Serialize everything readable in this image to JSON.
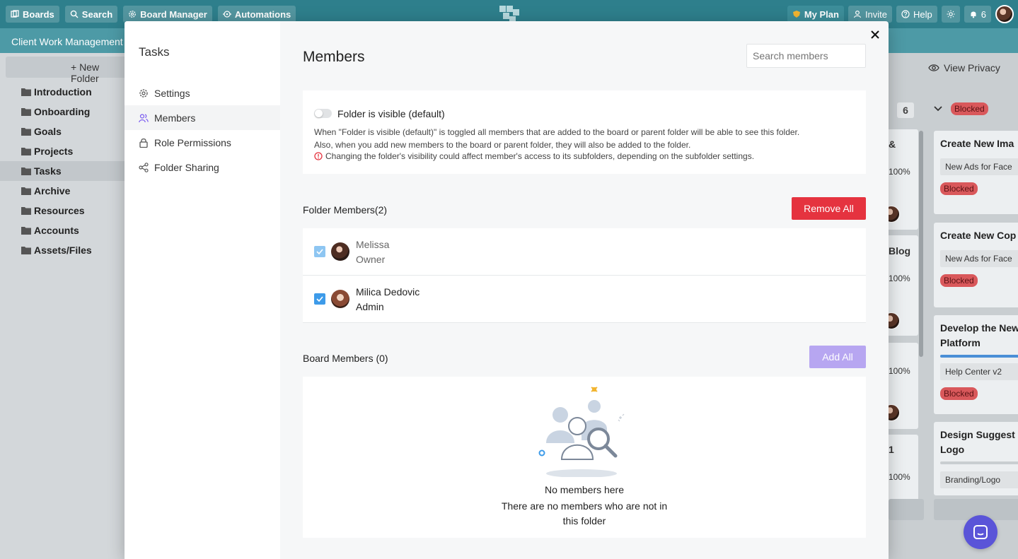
{
  "topbar": {
    "boards": "Boards",
    "search": "Search",
    "board_manager": "Board Manager",
    "automations": "Automations",
    "my_plan": "My Plan",
    "invite": "Invite",
    "help": "Help",
    "notifications_count": "6"
  },
  "workspace": {
    "title": "Client Work Management",
    "new_folder": "+ New Folder"
  },
  "folders": [
    "Introduction",
    "Onboarding",
    "Goals",
    "Projects",
    "Tasks",
    "Archive",
    "Resources",
    "Accounts",
    "Assets/Files"
  ],
  "board": {
    "view_privacy": "View Privacy",
    "column_count": "6",
    "blocked_label": "Blocked",
    "left_cards": [
      {
        "title": "&",
        "percent": "100%"
      },
      {
        "title": "Blog",
        "percent": "100%"
      },
      {
        "title": "",
        "percent": "100%"
      },
      {
        "title": "1",
        "percent": "100%"
      }
    ],
    "right_cards": [
      {
        "title": "Create New Ima",
        "tag": "New Ads for Face",
        "blocked": "Blocked"
      },
      {
        "title": "Create New Cop",
        "tag": "New Ads for Face",
        "blocked": "Blocked"
      },
      {
        "title": "Develop the New",
        "title2": "Platform",
        "tag": "Help Center v2",
        "blocked": "Blocked"
      },
      {
        "title": "Design Suggest",
        "title2": "Logo",
        "tag": "Branding/Logo",
        "blocked": ""
      }
    ]
  },
  "modal": {
    "sidebar_title": "Tasks",
    "nav": [
      "Settings",
      "Members",
      "Role Permissions",
      "Folder Sharing"
    ],
    "heading": "Members",
    "search_placeholder": "Search members",
    "visibility": {
      "label": "Folder is visible (default)",
      "desc_line1": "When \"Folder is visible (default)\" is toggled all members that are added to the board or parent folder will be able to see this folder.",
      "desc_line2": "Also, when you add new members to the board or parent folder, they will also be added to the folder.",
      "warning": "Changing the folder's visibility could affect member's access to its subfolders, depending on the subfolder settings."
    },
    "folder_members_title": "Folder Members(2)",
    "remove_all": "Remove All",
    "members": [
      {
        "name": "Melissa",
        "role": "Owner"
      },
      {
        "name": "Milica Dedovic",
        "role": "Admin"
      }
    ],
    "board_members_title": "Board Members (0)",
    "add_all": "Add All",
    "empty_title": "No members here",
    "empty_text": "There are no members who are not in this folder"
  }
}
